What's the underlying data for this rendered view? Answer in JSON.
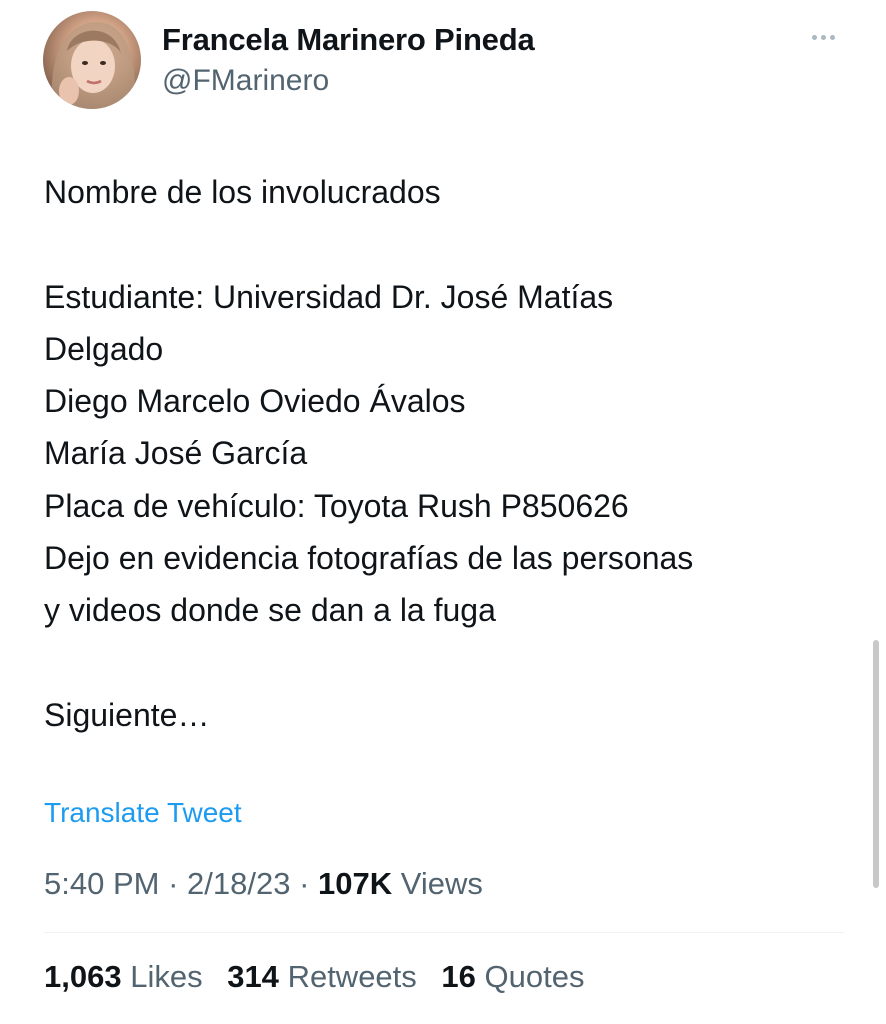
{
  "author": {
    "display_name": "Francela Marinero Pineda",
    "handle": "@FMarinero",
    "avatar_icon": "profile-photo"
  },
  "more_icon": "more-horizontal-icon",
  "tweet": {
    "text": "Nombre de los involucrados\n\nEstudiante: Universidad Dr. José Matías\nDelgado\nDiego Marcelo Oviedo Ávalos\nMaría José García\nPlaca de vehículo: Toyota Rush P850626\nDejo en evidencia fotografías de las personas\ny videos donde se dan a la fuga\n\nSiguiente…",
    "translate_label": "Translate Tweet"
  },
  "meta": {
    "time": "5:40 PM",
    "date": "2/18/23",
    "separator": "·",
    "views_count": "107K",
    "views_label": "Views"
  },
  "stats": {
    "likes_count": "1,063",
    "likes_label": "Likes",
    "retweets_count": "314",
    "retweets_label": "Retweets",
    "quotes_count": "16",
    "quotes_label": "Quotes"
  },
  "colors": {
    "link": "#1d9bf0",
    "secondary_text": "#536471",
    "primary_text": "#0f1419"
  }
}
